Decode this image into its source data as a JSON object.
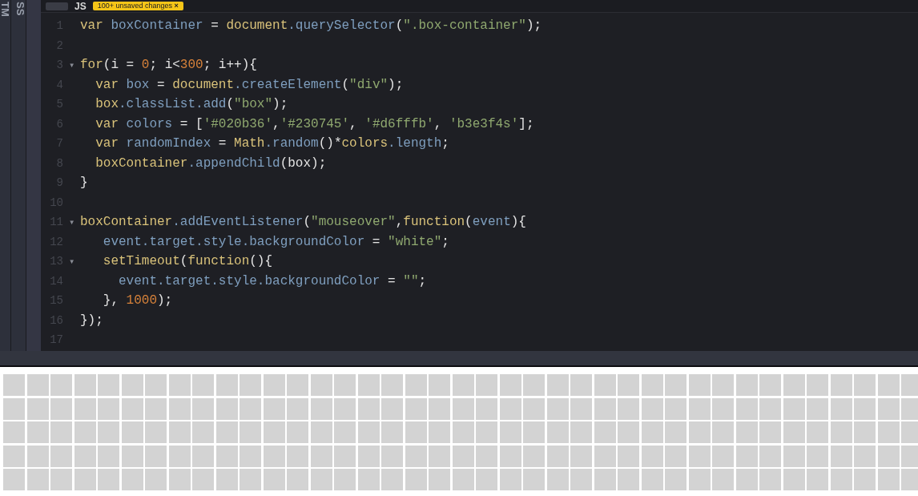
{
  "side_tabs": [
    {
      "label": "TM"
    },
    {
      "label": "SS"
    }
  ],
  "editor": {
    "language": "JS",
    "badge": "100+ unsaved changes",
    "badge_close": "×",
    "lines": [
      {
        "number": "1",
        "tokens": [
          {
            "text": "var ",
            "kind": "kw"
          },
          {
            "text": "boxContainer",
            "kind": "id"
          },
          {
            "text": " = ",
            "kind": "punc"
          },
          {
            "text": "document",
            "kind": "kw"
          },
          {
            "text": ".querySelector",
            "kind": "id"
          },
          {
            "text": "(",
            "kind": "punc"
          },
          {
            "text": "\".box-container\"",
            "kind": "str"
          },
          {
            "text": ");",
            "kind": "punc"
          }
        ]
      },
      {
        "number": "2"
      },
      {
        "number": "3",
        "fold": "▾",
        "tokens": [
          {
            "text": "for",
            "kind": "kw"
          },
          {
            "text": "(i = ",
            "kind": "punc"
          },
          {
            "text": "0",
            "kind": "num"
          },
          {
            "text": "; i<",
            "kind": "punc"
          },
          {
            "text": "300",
            "kind": "num"
          },
          {
            "text": "; i++){",
            "kind": "punc"
          }
        ]
      },
      {
        "number": "4",
        "tokens": [
          {
            "text": "  var ",
            "kind": "kw"
          },
          {
            "text": "box",
            "kind": "id"
          },
          {
            "text": " = ",
            "kind": "punc"
          },
          {
            "text": "document",
            "kind": "kw"
          },
          {
            "text": ".createElement",
            "kind": "id"
          },
          {
            "text": "(",
            "kind": "punc"
          },
          {
            "text": "\"div\"",
            "kind": "str"
          },
          {
            "text": ");",
            "kind": "punc"
          }
        ]
      },
      {
        "number": "5",
        "tokens": [
          {
            "text": "  box",
            "kind": "kw"
          },
          {
            "text": ".classList.add",
            "kind": "id"
          },
          {
            "text": "(",
            "kind": "punc"
          },
          {
            "text": "\"box\"",
            "kind": "str"
          },
          {
            "text": ");",
            "kind": "punc"
          }
        ]
      },
      {
        "number": "6",
        "tokens": [
          {
            "text": "  var ",
            "kind": "kw"
          },
          {
            "text": "colors",
            "kind": "id"
          },
          {
            "text": " = [",
            "kind": "punc"
          },
          {
            "text": "'#020b36'",
            "kind": "str"
          },
          {
            "text": ",",
            "kind": "punc"
          },
          {
            "text": "'#230745'",
            "kind": "str"
          },
          {
            "text": ", ",
            "kind": "punc"
          },
          {
            "text": "'#d6fffb'",
            "kind": "str"
          },
          {
            "text": ", ",
            "kind": "punc"
          },
          {
            "text": "'b3e3f4s'",
            "kind": "str"
          },
          {
            "text": "];",
            "kind": "punc"
          }
        ]
      },
      {
        "number": "7",
        "tokens": [
          {
            "text": "  var ",
            "kind": "kw"
          },
          {
            "text": "randomIndex",
            "kind": "id"
          },
          {
            "text": " = ",
            "kind": "punc"
          },
          {
            "text": "Math",
            "kind": "kw"
          },
          {
            "text": ".random",
            "kind": "id"
          },
          {
            "text": "()*",
            "kind": "punc"
          },
          {
            "text": "colors",
            "kind": "kw"
          },
          {
            "text": ".length",
            "kind": "id"
          },
          {
            "text": ";",
            "kind": "punc"
          }
        ]
      },
      {
        "number": "8",
        "tokens": [
          {
            "text": "  boxContainer",
            "kind": "kw"
          },
          {
            "text": ".appendChild",
            "kind": "id"
          },
          {
            "text": "(box);",
            "kind": "punc"
          }
        ]
      },
      {
        "number": "9",
        "tokens": [
          {
            "text": "}",
            "kind": "punc"
          }
        ]
      },
      {
        "number": "10"
      },
      {
        "number": "11",
        "fold": "▾",
        "tokens": [
          {
            "text": "boxContainer",
            "kind": "kw"
          },
          {
            "text": ".addEventListener",
            "kind": "id"
          },
          {
            "text": "(",
            "kind": "punc"
          },
          {
            "text": "\"mouseover\"",
            "kind": "str"
          },
          {
            "text": ",",
            "kind": "punc"
          },
          {
            "text": "function",
            "kind": "kw"
          },
          {
            "text": "(",
            "kind": "punc"
          },
          {
            "text": "event",
            "kind": "id"
          },
          {
            "text": "){",
            "kind": "punc"
          }
        ]
      },
      {
        "number": "12",
        "tokens": [
          {
            "text": "   event.target.style.backgroundColor",
            "kind": "id"
          },
          {
            "text": " = ",
            "kind": "punc"
          },
          {
            "text": "\"white\"",
            "kind": "str"
          },
          {
            "text": ";",
            "kind": "punc"
          }
        ]
      },
      {
        "number": "13",
        "fold": "▾",
        "tokens": [
          {
            "text": "   setTimeout",
            "kind": "kw"
          },
          {
            "text": "(",
            "kind": "punc"
          },
          {
            "text": "function",
            "kind": "kw"
          },
          {
            "text": "(){",
            "kind": "punc"
          }
        ]
      },
      {
        "number": "14",
        "tokens": [
          {
            "text": "     event.target.style.backgroundColor",
            "kind": "id"
          },
          {
            "text": " = ",
            "kind": "punc"
          },
          {
            "text": "\"\"",
            "kind": "str"
          },
          {
            "text": ";",
            "kind": "punc"
          }
        ]
      },
      {
        "number": "15",
        "tokens": [
          {
            "text": "   }, ",
            "kind": "punc"
          },
          {
            "text": "1000",
            "kind": "num"
          },
          {
            "text": ");",
            "kind": "punc"
          }
        ]
      },
      {
        "number": "16",
        "tokens": [
          {
            "text": "});",
            "kind": "punc"
          }
        ]
      },
      {
        "number": "17"
      }
    ]
  }
}
